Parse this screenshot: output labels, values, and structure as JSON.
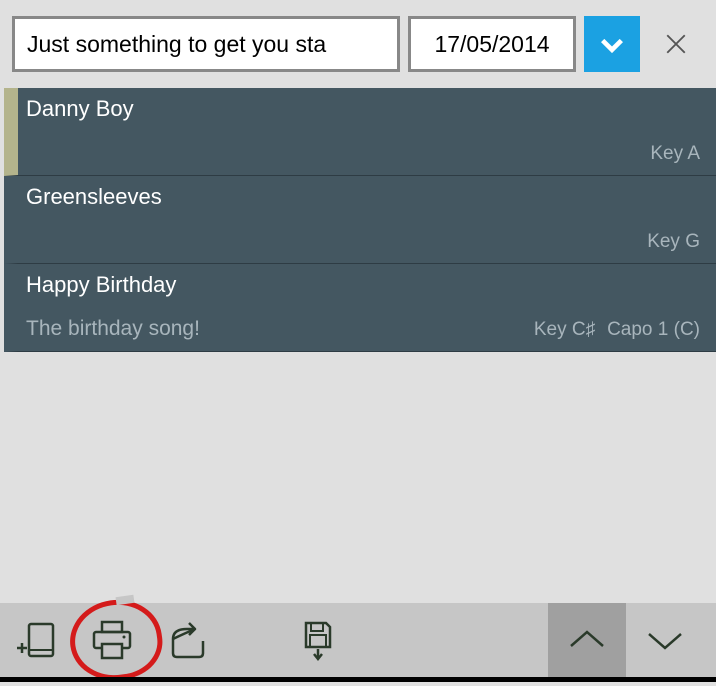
{
  "header": {
    "title_value": "Just something to get you sta",
    "date_value": "17/05/2014"
  },
  "songs": [
    {
      "title": "Danny Boy",
      "subtitle": "",
      "key": "Key A",
      "capo": "",
      "selected": true
    },
    {
      "title": "Greensleeves",
      "subtitle": "",
      "key": "Key G",
      "capo": "",
      "selected": false
    },
    {
      "title": "Happy Birthday",
      "subtitle": "The birthday song!",
      "key": "Key C♯",
      "capo": "Capo 1 (C)",
      "selected": false
    }
  ]
}
